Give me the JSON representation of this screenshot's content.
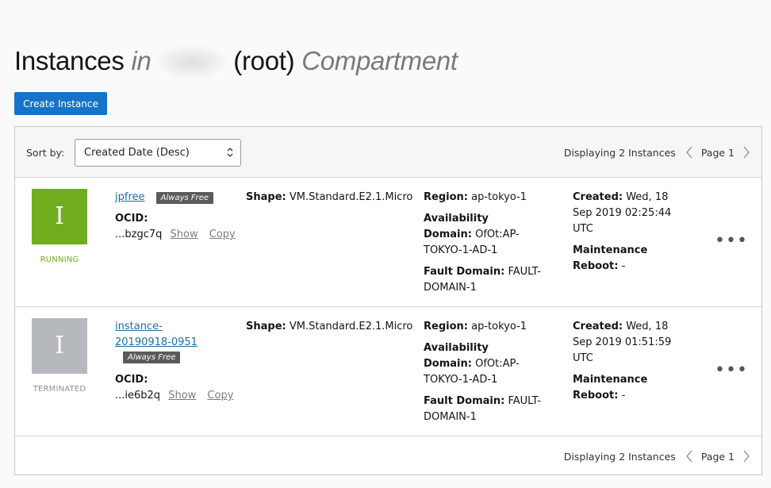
{
  "header": {
    "title_main": "Instances",
    "title_in": "in",
    "title_root": "(root)",
    "title_compartment": "Compartment"
  },
  "create_button": "Create Instance",
  "toolbar": {
    "sort_label": "Sort by:",
    "sort_value": "Created Date (Desc)",
    "displaying": "Displaying 2 Instances",
    "page": "Page 1"
  },
  "instances": [
    {
      "name": "jpfree",
      "badge": "Always Free",
      "tile_letter": "I",
      "state": "RUNNING",
      "ocid_label": "OCID:",
      "ocid": "...bzgc7q",
      "show": "Show",
      "copy": "Copy",
      "shape_label": "Shape:",
      "shape": "VM.Standard.E2.1.Micro",
      "region_label": "Region:",
      "region": "ap-tokyo-1",
      "ad_label_1": "Availability",
      "ad_label_2": "Domain:",
      "ad_value_1": "OfOt:AP-",
      "ad_value_2": "TOKYO-1-AD-1",
      "fd_label": "Fault Domain:",
      "fd_value_1": "FAULT-",
      "fd_value_2": "DOMAIN-1",
      "created_label": "Created:",
      "created_1": "Wed, 18",
      "created_2": "Sep 2019 02:25:44",
      "created_3": "UTC",
      "maint_label_1": "Maintenance",
      "maint_label_2": "Reboot:",
      "maint_value": "-",
      "menu": "•••"
    },
    {
      "name_1": "instance-",
      "name_2": "20190918-0951",
      "badge": "Always Free",
      "tile_letter": "I",
      "state": "TERMINATED",
      "ocid_label": "OCID:",
      "ocid": "...ie6b2q",
      "show": "Show",
      "copy": "Copy",
      "shape_label": "Shape:",
      "shape": "VM.Standard.E2.1.Micro",
      "region_label": "Region:",
      "region": "ap-tokyo-1",
      "ad_label_1": "Availability",
      "ad_label_2": "Domain:",
      "ad_value_1": "OfOt:AP-",
      "ad_value_2": "TOKYO-1-AD-1",
      "fd_label": "Fault Domain:",
      "fd_value_1": "FAULT-",
      "fd_value_2": "DOMAIN-1",
      "created_label": "Created:",
      "created_1": "Wed, 18",
      "created_2": "Sep 2019 01:51:59",
      "created_3": "UTC",
      "maint_label_1": "Maintenance",
      "maint_label_2": "Reboot:",
      "maint_value": "-",
      "menu": "•••"
    }
  ],
  "footer": {
    "displaying": "Displaying 2 Instances",
    "page": "Page 1"
  },
  "colors": {
    "accent": "#1773c9",
    "running": "#6fad1f",
    "terminated": "#b5b8bd",
    "link": "#1a6fa8"
  }
}
